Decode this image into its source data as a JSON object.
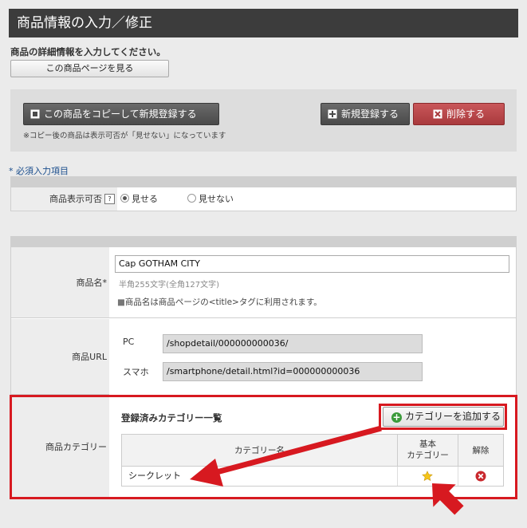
{
  "header": {
    "title": "商品情報の入力／修正"
  },
  "instruction": "商品の詳細情報を入力してください。",
  "view_page_button": "この商品ページを見る",
  "actions": {
    "copy_button": "この商品をコピーして新規登録する",
    "copy_note": "※コピー後の商品は表示可否が「見せない」になっています",
    "new_button": "新規登録する",
    "delete_button": "削除する"
  },
  "required_note": "* 必須入力項目",
  "visibility": {
    "label": "商品表示可否",
    "help": "?",
    "options": [
      {
        "label": "見せる",
        "selected": true
      },
      {
        "label": "見せない",
        "selected": false
      }
    ]
  },
  "product_name": {
    "label": "商品名*",
    "value": "Cap GOTHAM CITY",
    "limit": "半角255文字(全角127文字)",
    "tip": "商品名は商品ページの<title>タグに利用されます。"
  },
  "product_url": {
    "label": "商品URL",
    "pc_label": "PC",
    "pc_value": "/shopdetail/000000000036/",
    "sp_label": "スマホ",
    "sp_value": "/smartphone/detail.html?id=000000000036"
  },
  "category": {
    "label": "商品カテゴリー",
    "list_title": "登録済みカテゴリー一覧",
    "add_button": "カテゴリーを追加する",
    "columns": {
      "name": "カテゴリー名",
      "basic_line1": "基本",
      "basic_line2": "カテゴリー",
      "remove": "解除"
    },
    "rows": [
      {
        "name": "シークレット",
        "basic": true
      }
    ]
  },
  "colors": {
    "header_bg": "#3c3c3c",
    "delete_red": "#b84649",
    "highlight_red": "#d71920",
    "add_green": "#3a9a3a"
  }
}
